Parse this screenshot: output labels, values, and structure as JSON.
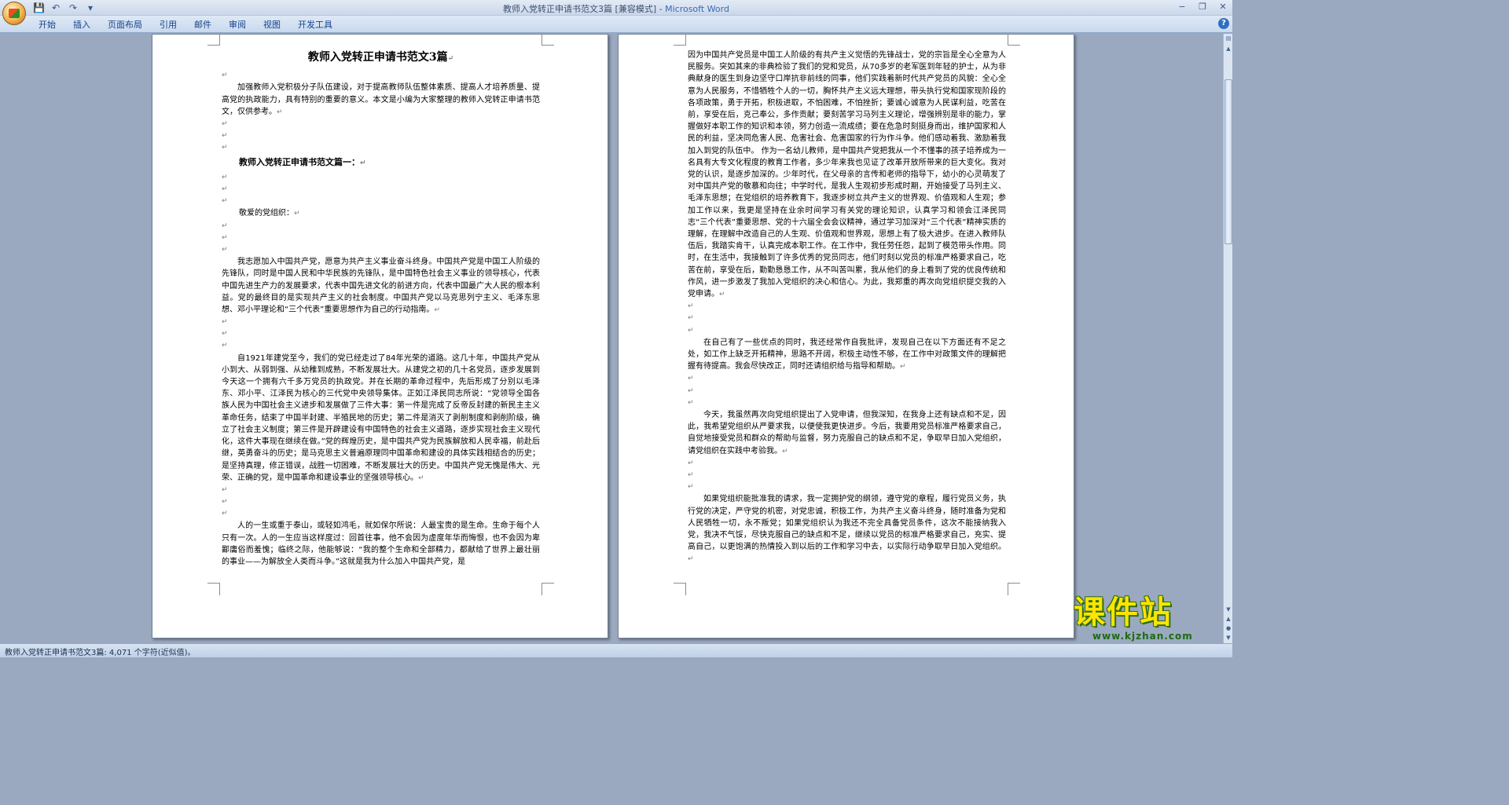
{
  "window": {
    "title_doc": "教师入党转正申请书范文3篇 [兼容模式] - ",
    "title_app": "Microsoft Word",
    "controls": [
      "−",
      "❐",
      "✕"
    ]
  },
  "quick_access": [
    "💾",
    "↶",
    "↷",
    "▾"
  ],
  "ribbon": {
    "tabs": [
      "开始",
      "插入",
      "页面布局",
      "引用",
      "邮件",
      "审阅",
      "视图",
      "开发工具"
    ],
    "help": "?"
  },
  "page1": {
    "title": "教师入党转正申请书范文3篇",
    "intro": "加强教师入党积极分子队伍建设，对于提高教师队伍整体素质、提高人才培养质量、提高党的执政能力，具有特别的重要的意义。本文是小编为大家整理的教师入党转正申请书范文，仅供参考。",
    "heading": "教师入党转正申请书范文篇一：",
    "salutation": "敬爱的党组织：",
    "para1": "我志愿加入中国共产党，愿意为共产主义事业奋斗终身。中国共产党是中国工人阶级的先锋队，同时是中国人民和中华民族的先锋队，是中国特色社会主义事业的领导核心，代表中国先进生产力的发展要求，代表中国先进文化的前进方向，代表中国最广大人民的根本利益。党的最终目的是实现共产主义的社会制度。中国共产党以马克思列宁主义、毛泽东思想、邓小平理论和“三个代表”重要思想作为自己的行动指南。",
    "para2": "自1921年建党至今，我们的党已经走过了84年光荣的道路。这几十年，中国共产党从小到大、从弱到强、从幼稚到成熟，不断发展壮大。从建党之初的几十名党员，逐步发展到今天这一个拥有六千多万党员的执政党。并在长期的革命过程中，先后形成了分别以毛泽东、邓小平、江泽民为核心的三代党中央领导集体。正如江泽民同志所说：“党领导全国各族人民为中国社会主义进步和发展做了三件大事：第一件是完成了反帝反封建的新民主主义革命任务，结束了中国半封建、半殖民地的历史；第二件是消灭了剥削制度和剥削阶级，确立了社会主义制度；第三件是开辟建设有中国特色的社会主义道路，逐步实现社会主义现代化，这件大事现在继续在做。”党的辉煌历史，是中国共产党为民族解放和人民幸福，前赴后继，英勇奋斗的历史；是马克思主义普遍原理同中国革命和建设的具体实践相结合的历史；是坚持真理，修正错误，战胜一切困难，不断发展壮大的历史。中国共产党无愧是伟大、光荣、正确的党，是中国革命和建设事业的坚强领导核心。",
    "para3": "人的一生或重于泰山，或轻如鸿毛，就如保尔所说：人最宝贵的是生命。生命于每个人只有一次。人的一生应当这样度过：回首往事，他不会因为虚度年华而悔恨，也不会因为卑鄙庸俗而羞愧；临终之际，他能够说：“我的整个生命和全部精力，都献给了世界上最壮丽的事业——为解放全人类而斗争。”这就是我为什么加入中国共产党，是"
  },
  "page2": {
    "para1": "因为中国共产党员是中国工人阶级的有共产主义觉悟的先锋战士，党的宗旨是全心全意为人民服务。突如其来的非典检验了我们的党和党员，从70多岁的老军医到年轻的护士，从为非典献身的医生到身边坚守口岸抗非前线的同事，他们实践着新时代共产党员的风貌：全心全意为人民服务，不惜牺牲个人的一切，胸怀共产主义远大理想，带头执行党和国家现阶段的各项政策，勇于开拓，积极进取，不怕困难，不怕挫折；要诚心诚意为人民谋利益，吃苦在前，享受在后，克己奉公，多作贡献；要刻苦学习马列主义理论，增强辨别是非的能力，掌握做好本职工作的知识和本领，努力创造一流成绩；要在危急时刻挺身而出，维护国家和人民的利益，坚决同危害人民、危害社会、危害国家的行为作斗争。他们感动着我、激励着我加入到党的队伍中。 作为一名幼儿教师，是中国共产党把我从一个不懂事的孩子培养成为一名具有大专文化程度的教育工作者，多少年来我也见证了改革开放所带来的巨大变化。我对党的认识，是逐步加深的。少年时代，在父母亲的言传和老师的指导下，幼小的心灵萌发了对中国共产党的敬慕和向往；中学时代，是我人生观初步形成时期，开始接受了马列主义、毛泽东思想；在党组织的培养教育下，我逐步树立共产主义的世界观、价值观和人生观；参加工作以来，我更是坚持在业余时间学习有关党的理论知识，认真学习和领会江泽民同志“三个代表”重要思想、党的十六届全会会议精神，通过学习加深对“三个代表”精神实质的理解，在理解中改造自己的人生观、价值观和世界观，思想上有了极大进步。在进入教师队伍后，我踏实肯干，认真完成本职工作。在工作中，我任劳任怨，起到了模范带头作用。同时，在生活中，我接触到了许多优秀的党员同志，他们时刻以党员的标准严格要求自己，吃苦在前，享受在后，勤勤恳恳工作，从不叫苦叫累，我从他们的身上看到了党的优良传统和作风，进一步激发了我加入党组织的决心和信心。为此，我郑重的再次向党组织提交我的入党申请。",
    "para2": "在自己有了一些优点的同时，我还经常作自我批评，发现自己在以下方面还有不足之处，如工作上缺乏开拓精神，思路不开阔，积极主动性不够，在工作中对政策文件的理解把握有待提高。我会尽快改正，同时还请组织给与指导和帮助。",
    "para3": "今天，我虽然再次向党组织提出了入党申请，但我深知，在我身上还有缺点和不足，因此，我希望党组织从严要求我，以便使我更快进步。今后，我要用党员标准严格要求自己，自觉地接受党员和群众的帮助与监督，努力克服自己的缺点和不足，争取早日加入党组织，请党组织在实践中考验我。",
    "para4": "如果党组织能批准我的请求，我一定拥护党的纲领，遵守党的章程，履行党员义务，执行党的决定，严守党的机密，对党忠诚，积极工作，为共产主义奋斗终身，随时准备为党和人民牺牲一切，永不叛党；如果党组织认为我还不完全具备党员条件，这次不能接纳我入党，我决不气馁，尽快克服自己的缺点和不足，继续以党员的标准严格要求自己，充实、提高自己，以更饱满的热情投入到以后的工作和学习中去，以实际行动争取早日加入党组织。"
  },
  "para_mark": "↵",
  "statusbar": {
    "text": "教师入党转正申请书范文3篇: 4,071 个字符(近似值)。"
  },
  "watermark": {
    "title": "课件站",
    "url": "www.kjzhan.com"
  }
}
